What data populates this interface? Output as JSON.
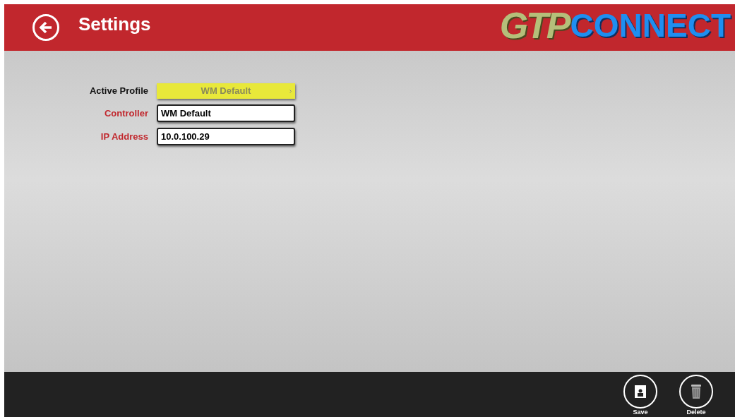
{
  "header": {
    "title": "Settings",
    "logo": {
      "part_1": "GTP",
      "part_2": "CONNECT"
    }
  },
  "form": {
    "active_profile": {
      "label": "Active Profile",
      "value": "WM Default"
    },
    "fields": [
      {
        "label": "Controller",
        "value": "WM Default"
      },
      {
        "label": "IP Address",
        "value": "10.0.100.29"
      }
    ]
  },
  "app_bar": {
    "buttons": [
      {
        "kind": "save",
        "label": "Save"
      },
      {
        "kind": "delete",
        "label": "Delete"
      }
    ]
  }
}
